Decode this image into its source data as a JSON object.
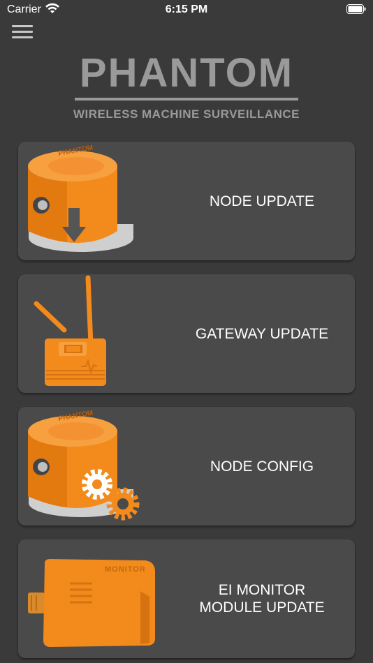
{
  "status_bar": {
    "carrier": "Carrier",
    "time": "6:15 PM",
    "icons": [
      "wifi-icon",
      "battery-icon"
    ]
  },
  "menu": {
    "icon": "hamburger-menu-icon"
  },
  "logo": {
    "title": "PHANTOM",
    "subtitle": "WIRELESS MACHINE SURVEILLANCE",
    "color": "#9a9a9a"
  },
  "colors": {
    "background": "#3a3a3a",
    "card": "#4a4a4a",
    "accent_orange": "#f28a1c"
  },
  "cards": [
    {
      "label": "NODE UPDATE",
      "icon": "node-update-icon",
      "icon_text": "PHANTOM"
    },
    {
      "label": "GATEWAY UPDATE",
      "icon": "gateway-update-icon"
    },
    {
      "label": "NODE CONFIG",
      "icon": "node-config-icon",
      "icon_text": "PHANTOM"
    },
    {
      "label_line1": "EI MONITOR",
      "label_line2": "MODULE UPDATE",
      "icon": "monitor-module-icon",
      "icon_text": "MONITOR"
    }
  ]
}
